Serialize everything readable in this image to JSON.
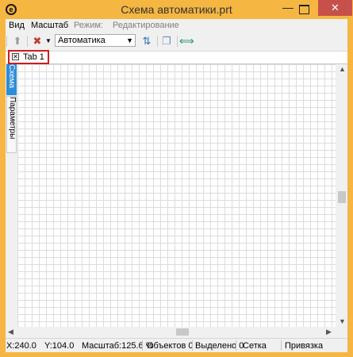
{
  "window": {
    "title": "Схема автоматики.prt",
    "app_icon_glyph": "e",
    "minimize_glyph": "—",
    "close_glyph": "✕"
  },
  "menu": {
    "items": [
      "Вид",
      "Масштаб"
    ],
    "mode_label": "Режим:",
    "mode_value": "Редактирование"
  },
  "toolbar": {
    "icons": [
      "arrow-up-icon",
      "tools-icon",
      "dropdown-arrow-icon",
      "layers-icon",
      "copy-icon",
      "refresh-icon"
    ],
    "combo_value": "Автоматика"
  },
  "tabs": {
    "items": [
      {
        "label": "Tab 1"
      }
    ]
  },
  "side": {
    "active": "Схема",
    "inactive": "Параметры"
  },
  "status": {
    "x": "X:240.0",
    "y": "Y:104.0",
    "zoom": "Масштаб:125.6 %",
    "objects": "Объектов 0",
    "selected": "Выделено 0",
    "grid": "Сетка",
    "snap": "Привязка"
  },
  "colors": {
    "frame": "#f5b642",
    "close": "#c7504a",
    "tab_highlight": "#d01c1c",
    "side_active": "#2e8cd8",
    "grid_line": "#dcdcdc"
  }
}
